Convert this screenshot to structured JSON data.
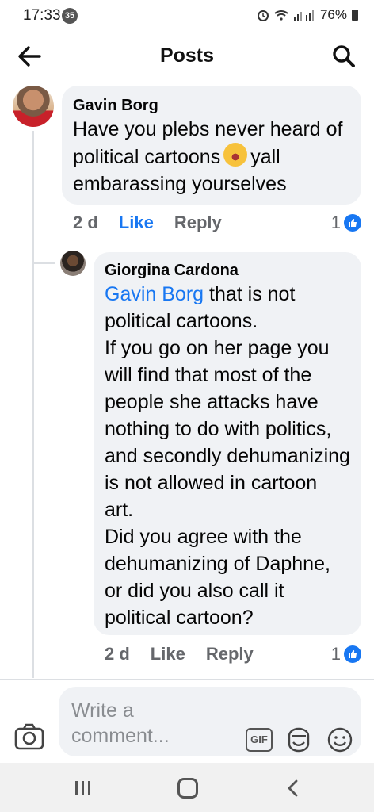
{
  "status_bar": {
    "time": "17:33",
    "notification_count": "35",
    "battery": "76%"
  },
  "header": {
    "title": "Posts"
  },
  "comments": [
    {
      "author": "Gavin Borg",
      "text_before_emoji": "Have you plebs never heard of political cartoons",
      "emoji": "rolling-on-floor-laughing-emoji",
      "text_after_emoji": "yall embarassing yourselves",
      "age": "2 d",
      "like_label": "Like",
      "reply_label": "Reply",
      "reaction_count": "1"
    },
    {
      "author": "Giorgina Cardona",
      "mention": "Gavin Borg",
      "text": " that is not political cartoons.\nIf you go on her page  you will find that most of the people she attacks have nothing to do with politics, and secondly dehumanizing is not allowed in cartoon art.\nDid you agree with the dehumanizing of Daphne, or did you also call it political cartoon?",
      "age": "2 d",
      "like_label": "Like",
      "reply_label": "Reply",
      "reaction_count": "1"
    }
  ],
  "composer": {
    "placeholder": "Write a comment...",
    "gif_label": "GIF"
  },
  "colors": {
    "accent": "#1877f2",
    "bubble": "#f0f2f5",
    "muted": "#65676b"
  }
}
